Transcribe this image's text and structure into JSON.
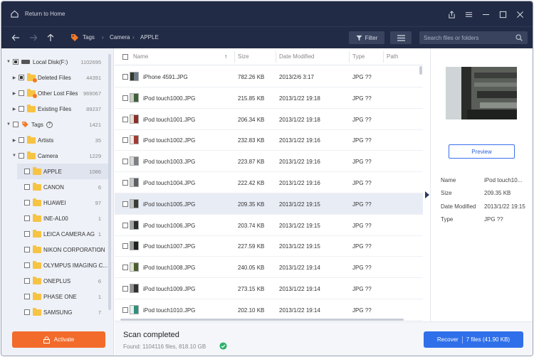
{
  "titlebar": {
    "title": "Return to Home"
  },
  "nav": {
    "crumbs": [
      "Tags",
      "Camera",
      "APPLE"
    ],
    "filter_label": "Filter",
    "search_placeholder": "Search files or folders"
  },
  "sidebar": {
    "items": [
      {
        "label": "Local Disk(F:)",
        "count": "1102695"
      },
      {
        "label": "Deleted Files",
        "count": "44391"
      },
      {
        "label": "Other Lost Files",
        "count": "969067"
      },
      {
        "label": "Existing Files",
        "count": "89237"
      },
      {
        "label": "Tags",
        "count": "1421"
      },
      {
        "label": "Artists",
        "count": "35"
      },
      {
        "label": "Camera",
        "count": "1229"
      },
      {
        "label": "APPLE",
        "count": "1086"
      },
      {
        "label": "CANON",
        "count": "6"
      },
      {
        "label": "HUAWEI",
        "count": "97"
      },
      {
        "label": "INE-AL00",
        "count": "1"
      },
      {
        "label": "LEICA CAMERA AG",
        "count": "1"
      },
      {
        "label": "NIKON CORPORATION",
        "count": "3"
      },
      {
        "label": "OLYMPUS IMAGING C...",
        "count": "1"
      },
      {
        "label": "ONEPLUS",
        "count": "6"
      },
      {
        "label": "PHASE ONE",
        "count": "1"
      },
      {
        "label": "SAMSUNG",
        "count": "7"
      }
    ],
    "tags_help": "?",
    "activate_label": "Activate"
  },
  "list": {
    "columns": [
      "Name",
      "Size",
      "Date Modified",
      "Type",
      "Path"
    ],
    "rows": [
      {
        "name": "iPhone 4591.JPG",
        "size": "782.26 KB",
        "date": "2013/2/6 3:17",
        "type": "JPG ??"
      },
      {
        "name": "iPod touch1000.JPG",
        "size": "215.85 KB",
        "date": "2013/1/22 19:18",
        "type": "JPG ??"
      },
      {
        "name": "iPod touch1001.JPG",
        "size": "206.34 KB",
        "date": "2013/1/22 19:18",
        "type": "JPG ??"
      },
      {
        "name": "iPod touch1002.JPG",
        "size": "232.83 KB",
        "date": "2013/1/22 19:16",
        "type": "JPG ??"
      },
      {
        "name": "iPod touch1003.JPG",
        "size": "223.87 KB",
        "date": "2013/1/22 19:16",
        "type": "JPG ??"
      },
      {
        "name": "iPod touch1004.JPG",
        "size": "222.42 KB",
        "date": "2013/1/22 19:16",
        "type": "JPG ??"
      },
      {
        "name": "iPod touch1005.JPG",
        "size": "209.35 KB",
        "date": "2013/1/22 19:15",
        "type": "JPG ??"
      },
      {
        "name": "iPod touch1006.JPG",
        "size": "203.74 KB",
        "date": "2013/1/22 19:15",
        "type": "JPG ??"
      },
      {
        "name": "iPod touch1007.JPG",
        "size": "227.59 KB",
        "date": "2013/1/22 19:15",
        "type": "JPG ??"
      },
      {
        "name": "iPod touch1008.JPG",
        "size": "240.05 KB",
        "date": "2013/1/22 19:14",
        "type": "JPG ??"
      },
      {
        "name": "iPod touch1009.JPG",
        "size": "273.15 KB",
        "date": "2013/1/22 19:14",
        "type": "JPG ??"
      },
      {
        "name": "iPod touch1010.JPG",
        "size": "202.10 KB",
        "date": "2013/1/22 19:14",
        "type": "JPG ??"
      }
    ]
  },
  "preview": {
    "button_label": "Preview",
    "labels": [
      "Name",
      "Size",
      "Date Modified",
      "Type"
    ],
    "values": [
      "iPod touch10...",
      "209.35 KB",
      "2013/1/22 19:15",
      "JPG ??"
    ]
  },
  "status": {
    "title": "Scan completed",
    "summary": "Found: 1104116 files, 818.10 GB",
    "recover_label": "Recover",
    "recover_detail": "7 files (41.90 KB)"
  },
  "colors": {
    "header_bg": "#222b45",
    "accent_blue": "#2f6fe9",
    "activate_orange": "#f26b2a",
    "folder_yellow": "#f7c343"
  }
}
